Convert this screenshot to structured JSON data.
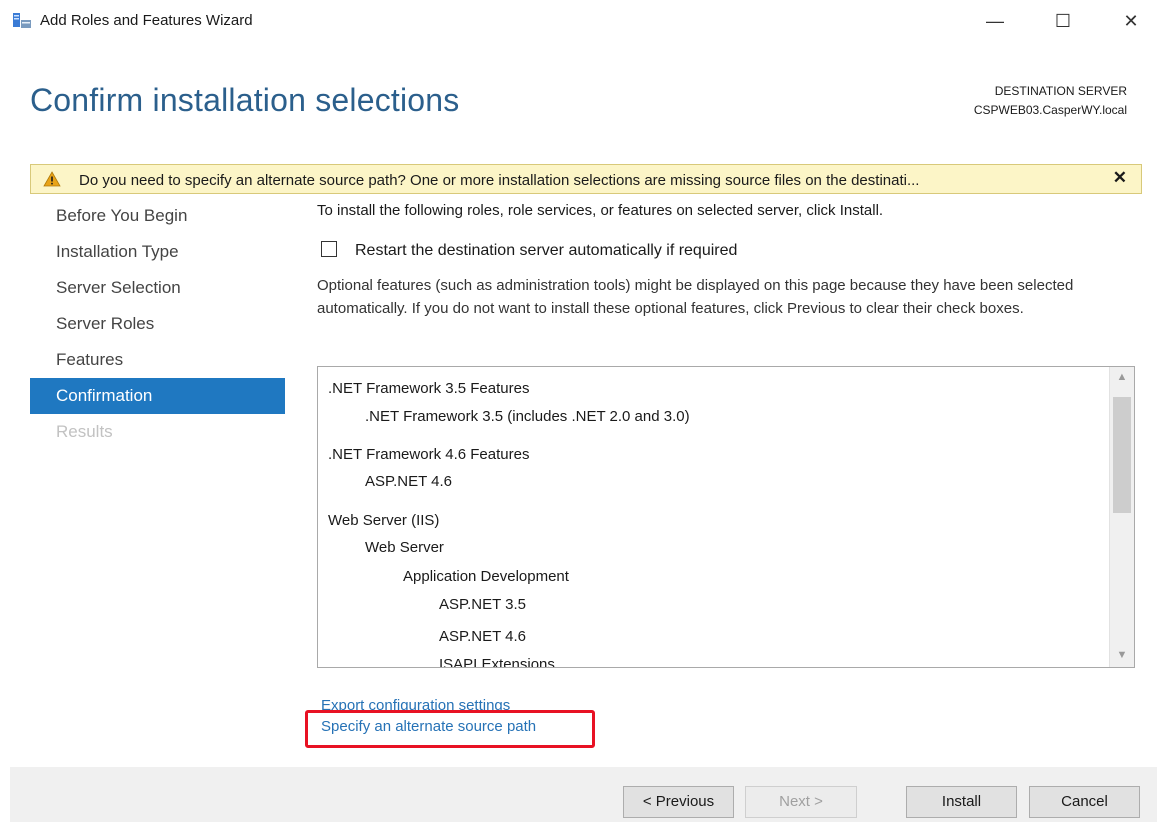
{
  "window": {
    "title": "Add Roles and Features Wizard",
    "minimize": "—",
    "maximize": "☐",
    "close": "✕"
  },
  "header": {
    "page_title": "Confirm installation selections",
    "destination_label": "DESTINATION SERVER",
    "destination_server": "CSPWEB03.CasperWY.local"
  },
  "warning": {
    "text": "Do you need to specify an alternate source path? One or more installation selections are missing source files on the destinati...",
    "close": "✕",
    "color": "#fcf5c7"
  },
  "nav": {
    "items": [
      {
        "label": "Before You Begin",
        "state": "normal"
      },
      {
        "label": "Installation Type",
        "state": "normal"
      },
      {
        "label": "Server Selection",
        "state": "normal"
      },
      {
        "label": "Server Roles",
        "state": "normal"
      },
      {
        "label": "Features",
        "state": "normal"
      },
      {
        "label": "Confirmation",
        "state": "active"
      },
      {
        "label": "Results",
        "state": "disabled"
      }
    ],
    "active_color": "#1f78c1"
  },
  "content": {
    "intro": "To install the following roles, role services, or features on selected server, click Install.",
    "restart_label": "Restart the destination server automatically if required",
    "restart_checked": false,
    "optional_text": "Optional features (such as administration tools) might be displayed on this page because they have been selected automatically. If you do not want to install these optional features, click Previous to clear their check boxes."
  },
  "features": [
    {
      "label": ".NET Framework 3.5 Features",
      "level": 0
    },
    {
      "label": ".NET Framework 3.5 (includes .NET 2.0 and 3.0)",
      "level": 1
    },
    {
      "label": ".NET Framework 4.6 Features",
      "level": 0
    },
    {
      "label": "ASP.NET 4.6",
      "level": 1
    },
    {
      "label": "Web Server (IIS)",
      "level": 0
    },
    {
      "label": "Web Server",
      "level": 1
    },
    {
      "label": "Application Development",
      "level": 2
    },
    {
      "label": "ASP.NET 3.5",
      "level": 3
    },
    {
      "label": "ASP.NET 4.6",
      "level": 3
    },
    {
      "label": "ISAPI Extensions",
      "level": 3
    }
  ],
  "links": {
    "export": "Export configuration settings",
    "alternate_source": "Specify an alternate source path"
  },
  "buttons": {
    "previous": "< Previous",
    "next": "Next >",
    "install": "Install",
    "cancel": "Cancel"
  },
  "colors": {
    "title": "#2b5f8c",
    "link": "#2672b6",
    "highlight": "#e81123"
  }
}
